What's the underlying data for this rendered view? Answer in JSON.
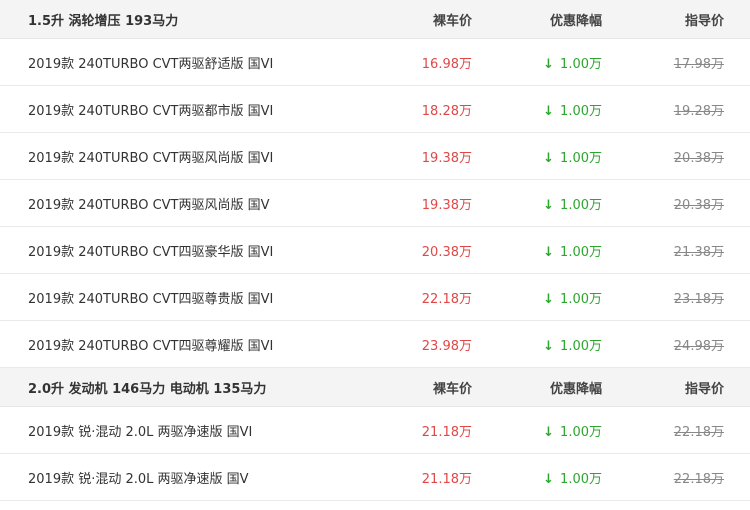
{
  "groups": [
    {
      "title": "1.5升 涡轮增压 193马力",
      "col_price": "裸车价",
      "col_discount": "优惠降幅",
      "col_guide": "指导价",
      "rows": [
        {
          "name": "2019款 240TURBO CVT两驱舒适版 国VI",
          "price": "16.98万",
          "discount": "1.00万",
          "guide": "17.98万"
        },
        {
          "name": "2019款 240TURBO CVT两驱都市版 国VI",
          "price": "18.28万",
          "discount": "1.00万",
          "guide": "19.28万"
        },
        {
          "name": "2019款 240TURBO CVT两驱风尚版 国VI",
          "price": "19.38万",
          "discount": "1.00万",
          "guide": "20.38万"
        },
        {
          "name": "2019款 240TURBO CVT两驱风尚版 国V",
          "price": "19.38万",
          "discount": "1.00万",
          "guide": "20.38万"
        },
        {
          "name": "2019款 240TURBO CVT四驱豪华版 国VI",
          "price": "20.38万",
          "discount": "1.00万",
          "guide": "21.38万"
        },
        {
          "name": "2019款 240TURBO CVT四驱尊贵版 国VI",
          "price": "22.18万",
          "discount": "1.00万",
          "guide": "23.18万"
        },
        {
          "name": "2019款 240TURBO CVT四驱尊耀版 国VI",
          "price": "23.98万",
          "discount": "1.00万",
          "guide": "24.98万"
        }
      ]
    },
    {
      "title": "2.0升 发动机 146马力 电动机 135马力",
      "col_price": "裸车价",
      "col_discount": "优惠降幅",
      "col_guide": "指导价",
      "rows": [
        {
          "name": "2019款 锐·混动 2.0L 两驱净速版 国VI",
          "price": "21.18万",
          "discount": "1.00万",
          "guide": "22.18万"
        },
        {
          "name": "2019款 锐·混动 2.0L 两驱净速版 国V",
          "price": "21.18万",
          "discount": "1.00万",
          "guide": "22.18万"
        }
      ]
    }
  ],
  "icons": {
    "discount_arrow": "down-arrow-icon"
  },
  "colors": {
    "price": "#e04848",
    "discount": "#2ea62e",
    "guide": "#888888",
    "header_bg": "#f4f4f4"
  }
}
